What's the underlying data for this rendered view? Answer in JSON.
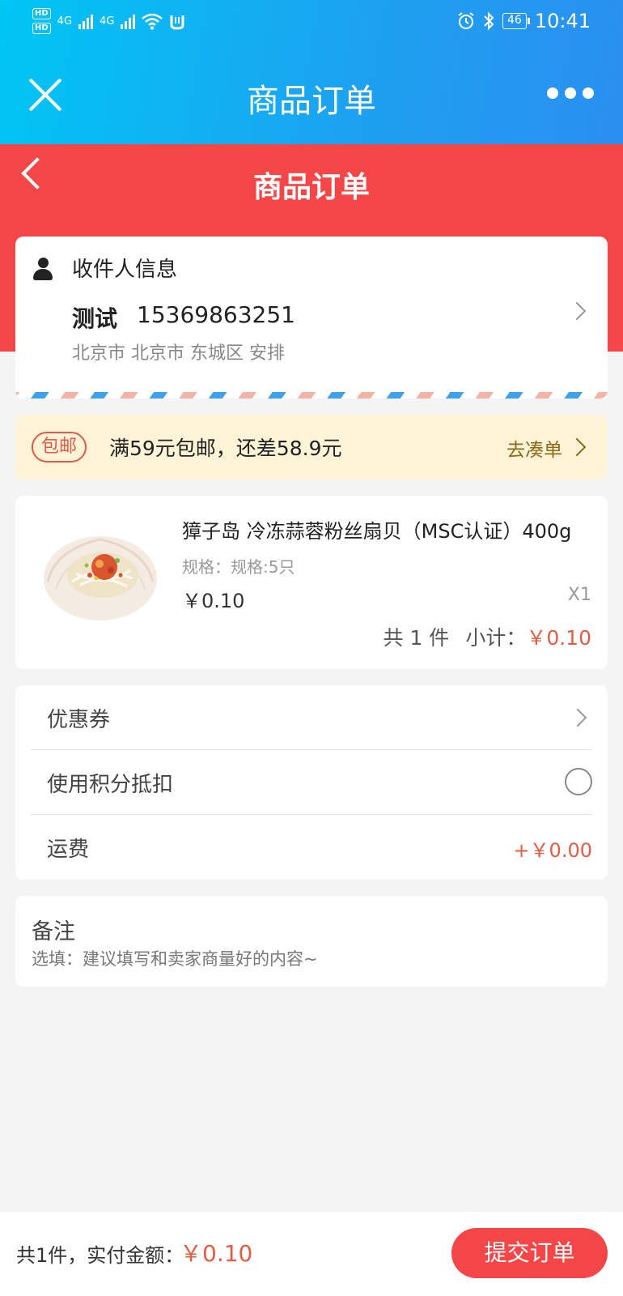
{
  "status_bar": {
    "hd1": "HD",
    "hd2": "HD",
    "net1": "4G",
    "net2": "4G",
    "battery": "46",
    "time": "10:41"
  },
  "app_bar": {
    "title": "商品订单"
  },
  "header": {
    "title": "商品订单"
  },
  "recipient": {
    "label": "收件人信息",
    "name": "测试",
    "phone": "15369863251",
    "address": "北京市 北京市 东城区 安排"
  },
  "promo": {
    "tag": "包邮",
    "text": "满59元包邮，还差58.9元",
    "link": "去凑单"
  },
  "product": {
    "name": "獐子岛 冷冻蒜蓉粉丝扇贝（MSC认证）400g",
    "spec": "规格：规格:5只",
    "price": "￥0.10",
    "qty": "X1",
    "count_text": "共 1 件",
    "subtotal_label": "小计：",
    "subtotal": "￥0.10"
  },
  "options": {
    "coupon": "优惠券",
    "points": "使用积分抵扣",
    "shipping": "运费",
    "shipping_value": "+￥0.00"
  },
  "remark": {
    "label": "备注",
    "hint": "选填：建议填写和卖家商量好的内容~"
  },
  "footer": {
    "summary": "共1件，实付金额：",
    "amount": "￥0.10",
    "submit": "提交订单"
  },
  "colors": {
    "header_red": "#f44647",
    "price_red": "#e35c45",
    "promo_bg": "#fdf3d6",
    "top_blue": "#1ea0f0"
  }
}
